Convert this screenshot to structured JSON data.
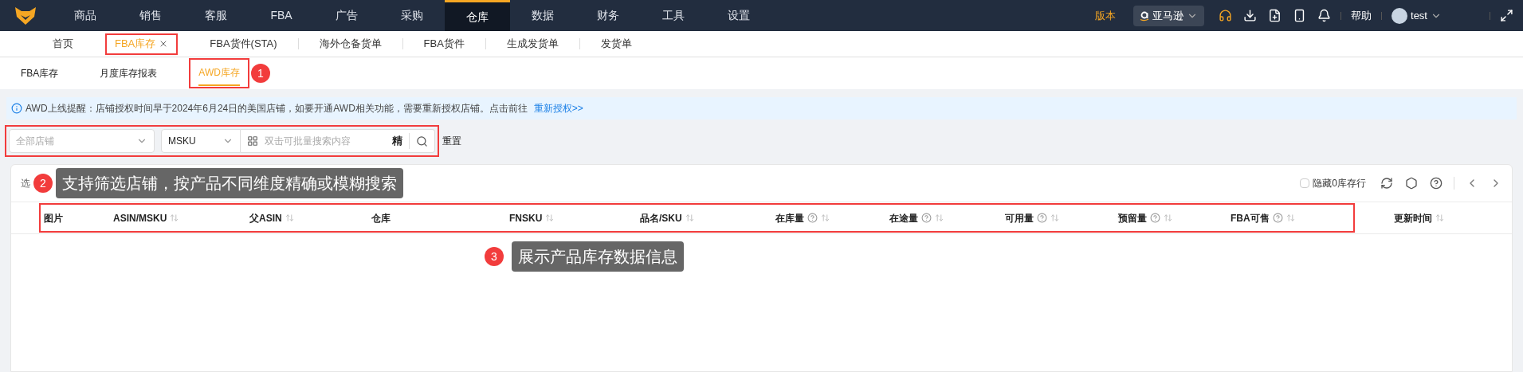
{
  "nav": {
    "items": [
      {
        "label": "商品",
        "selected": false
      },
      {
        "label": "销售",
        "selected": false
      },
      {
        "label": "客服",
        "selected": false
      },
      {
        "label": "FBA",
        "selected": false
      },
      {
        "label": "广告",
        "selected": false
      },
      {
        "label": "采购",
        "selected": false
      },
      {
        "label": "仓库",
        "selected": true
      },
      {
        "label": "数据",
        "selected": false
      },
      {
        "label": "财务",
        "selected": false
      },
      {
        "label": "工具",
        "selected": false
      },
      {
        "label": "设置",
        "selected": false
      }
    ],
    "version": "版本",
    "platform": "亚马逊",
    "help": "帮助",
    "user": "test"
  },
  "page_tabs": [
    {
      "label": "首页",
      "selected": false,
      "closable": false,
      "outlined": false
    },
    {
      "label": "FBA库存",
      "selected": true,
      "closable": true,
      "outlined": true
    },
    {
      "label": "FBA货件(STA)",
      "selected": false,
      "closable": false,
      "outlined": false
    },
    {
      "label": "海外仓备货单",
      "selected": false,
      "closable": false,
      "outlined": false
    },
    {
      "label": "FBA货件",
      "selected": false,
      "closable": false,
      "outlined": false
    },
    {
      "label": "生成发货单",
      "selected": false,
      "closable": false,
      "outlined": false
    },
    {
      "label": "发货单",
      "selected": false,
      "closable": false,
      "outlined": false
    }
  ],
  "sub_tabs": [
    {
      "label": "FBA库存",
      "selected": false,
      "outlined": false
    },
    {
      "label": "月度库存报表",
      "selected": false,
      "outlined": false
    },
    {
      "label": "AWD库存",
      "selected": true,
      "outlined": true
    }
  ],
  "notice": {
    "text": "AWD上线提醒：店铺授权时间早于2024年6月24日的美国店铺，如要开通AWD相关功能，需要重新授权店铺。点击前往",
    "link": "重新授权>>"
  },
  "filters": {
    "outlined": true,
    "store": {
      "placeholder": "全部店铺"
    },
    "field": {
      "value": "MSKU"
    },
    "search": {
      "placeholder": "双击可批量搜索内容"
    },
    "exact": "精",
    "reset": "重置"
  },
  "toolbar": {
    "selection": "选",
    "hide_zero": {
      "label": "隐藏0库存行",
      "checked": false
    }
  },
  "table": {
    "header_outlined": true,
    "columns": [
      {
        "label": "图片",
        "help": false,
        "sortable": false
      },
      {
        "label": "ASIN/MSKU",
        "help": false,
        "sortable": true
      },
      {
        "label": "父ASIN",
        "help": false,
        "sortable": true
      },
      {
        "label": "仓库",
        "help": false,
        "sortable": false
      },
      {
        "label": "FNSKU",
        "help": false,
        "sortable": true
      },
      {
        "label": "品名/SKU",
        "help": false,
        "sortable": true
      },
      {
        "label": "在库量",
        "help": true,
        "sortable": true
      },
      {
        "label": "在途量",
        "help": true,
        "sortable": true
      },
      {
        "label": "可用量",
        "help": true,
        "sortable": true
      },
      {
        "label": "预留量",
        "help": true,
        "sortable": true
      },
      {
        "label": "FBA可售",
        "help": true,
        "sortable": true
      },
      {
        "label": "更新时间",
        "help": false,
        "sortable": true
      }
    ]
  },
  "annotations": [
    {
      "number": "1"
    },
    {
      "number": "2",
      "text": "支持筛选店铺，按产品不同维度精确或模糊搜索"
    },
    {
      "number": "3",
      "text": "展示产品库存数据信息"
    }
  ]
}
